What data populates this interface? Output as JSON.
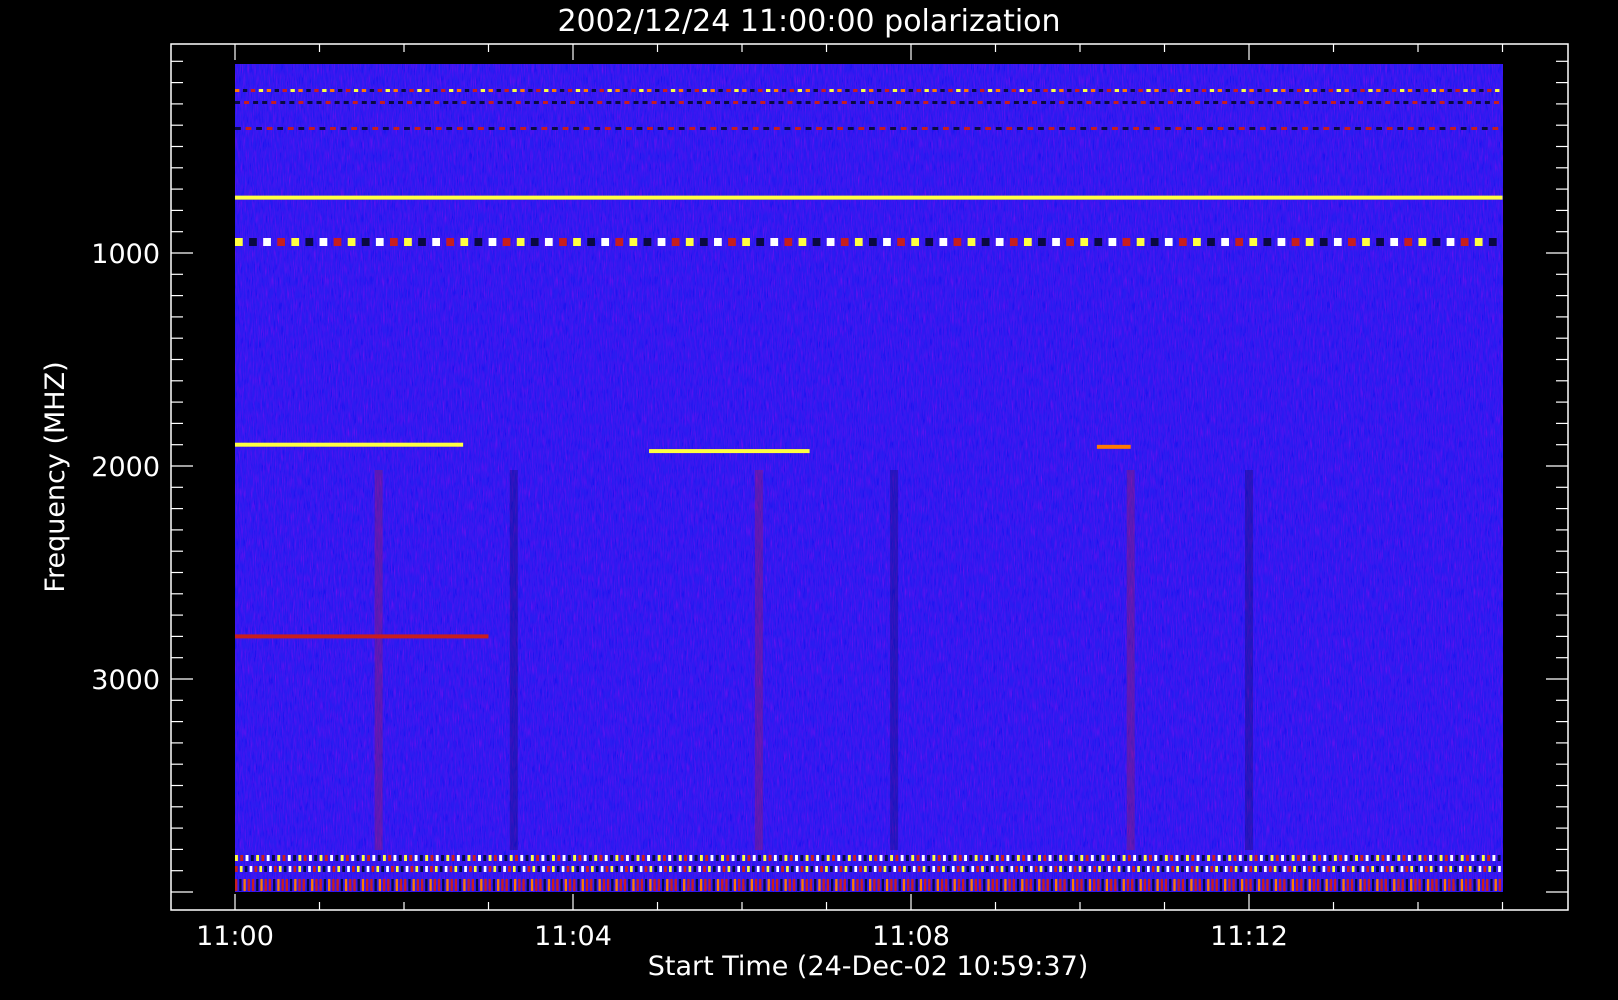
{
  "chart_data": {
    "type": "heatmap",
    "title": "2002/12/24 11:00:00 polarization",
    "xlabel": "Start Time (24-Dec-02 10:59:37)",
    "ylabel": "Frequency (MHZ)",
    "x_tick_labels": [
      "11:00",
      "11:04",
      "11:08",
      "11:12"
    ],
    "y_tick_labels": [
      "1000",
      "2000",
      "3000"
    ],
    "colors": {
      "background": "#000000",
      "base": "#2a1cf0",
      "dark": "#0a0a40",
      "red": "#c81e1e",
      "orange": "#ff7a00",
      "yellow": "#ffff40",
      "axis": "#ffffff"
    },
    "features": [
      {
        "kind": "hline",
        "freq": 740,
        "t0": 0.0,
        "t1": 15.0,
        "color": "yellow"
      },
      {
        "kind": "hline",
        "freq": 1900,
        "t0": 0.0,
        "t1": 2.7,
        "color": "yellow"
      },
      {
        "kind": "hline",
        "freq": 1930,
        "t0": 4.9,
        "t1": 6.8,
        "color": "yellow"
      },
      {
        "kind": "hline",
        "freq": 1910,
        "t0": 10.2,
        "t1": 10.6,
        "color": "orange"
      },
      {
        "kind": "hline",
        "freq": 2800,
        "t0": 0.0,
        "t1": 3.0,
        "color": "red"
      }
    ]
  }
}
